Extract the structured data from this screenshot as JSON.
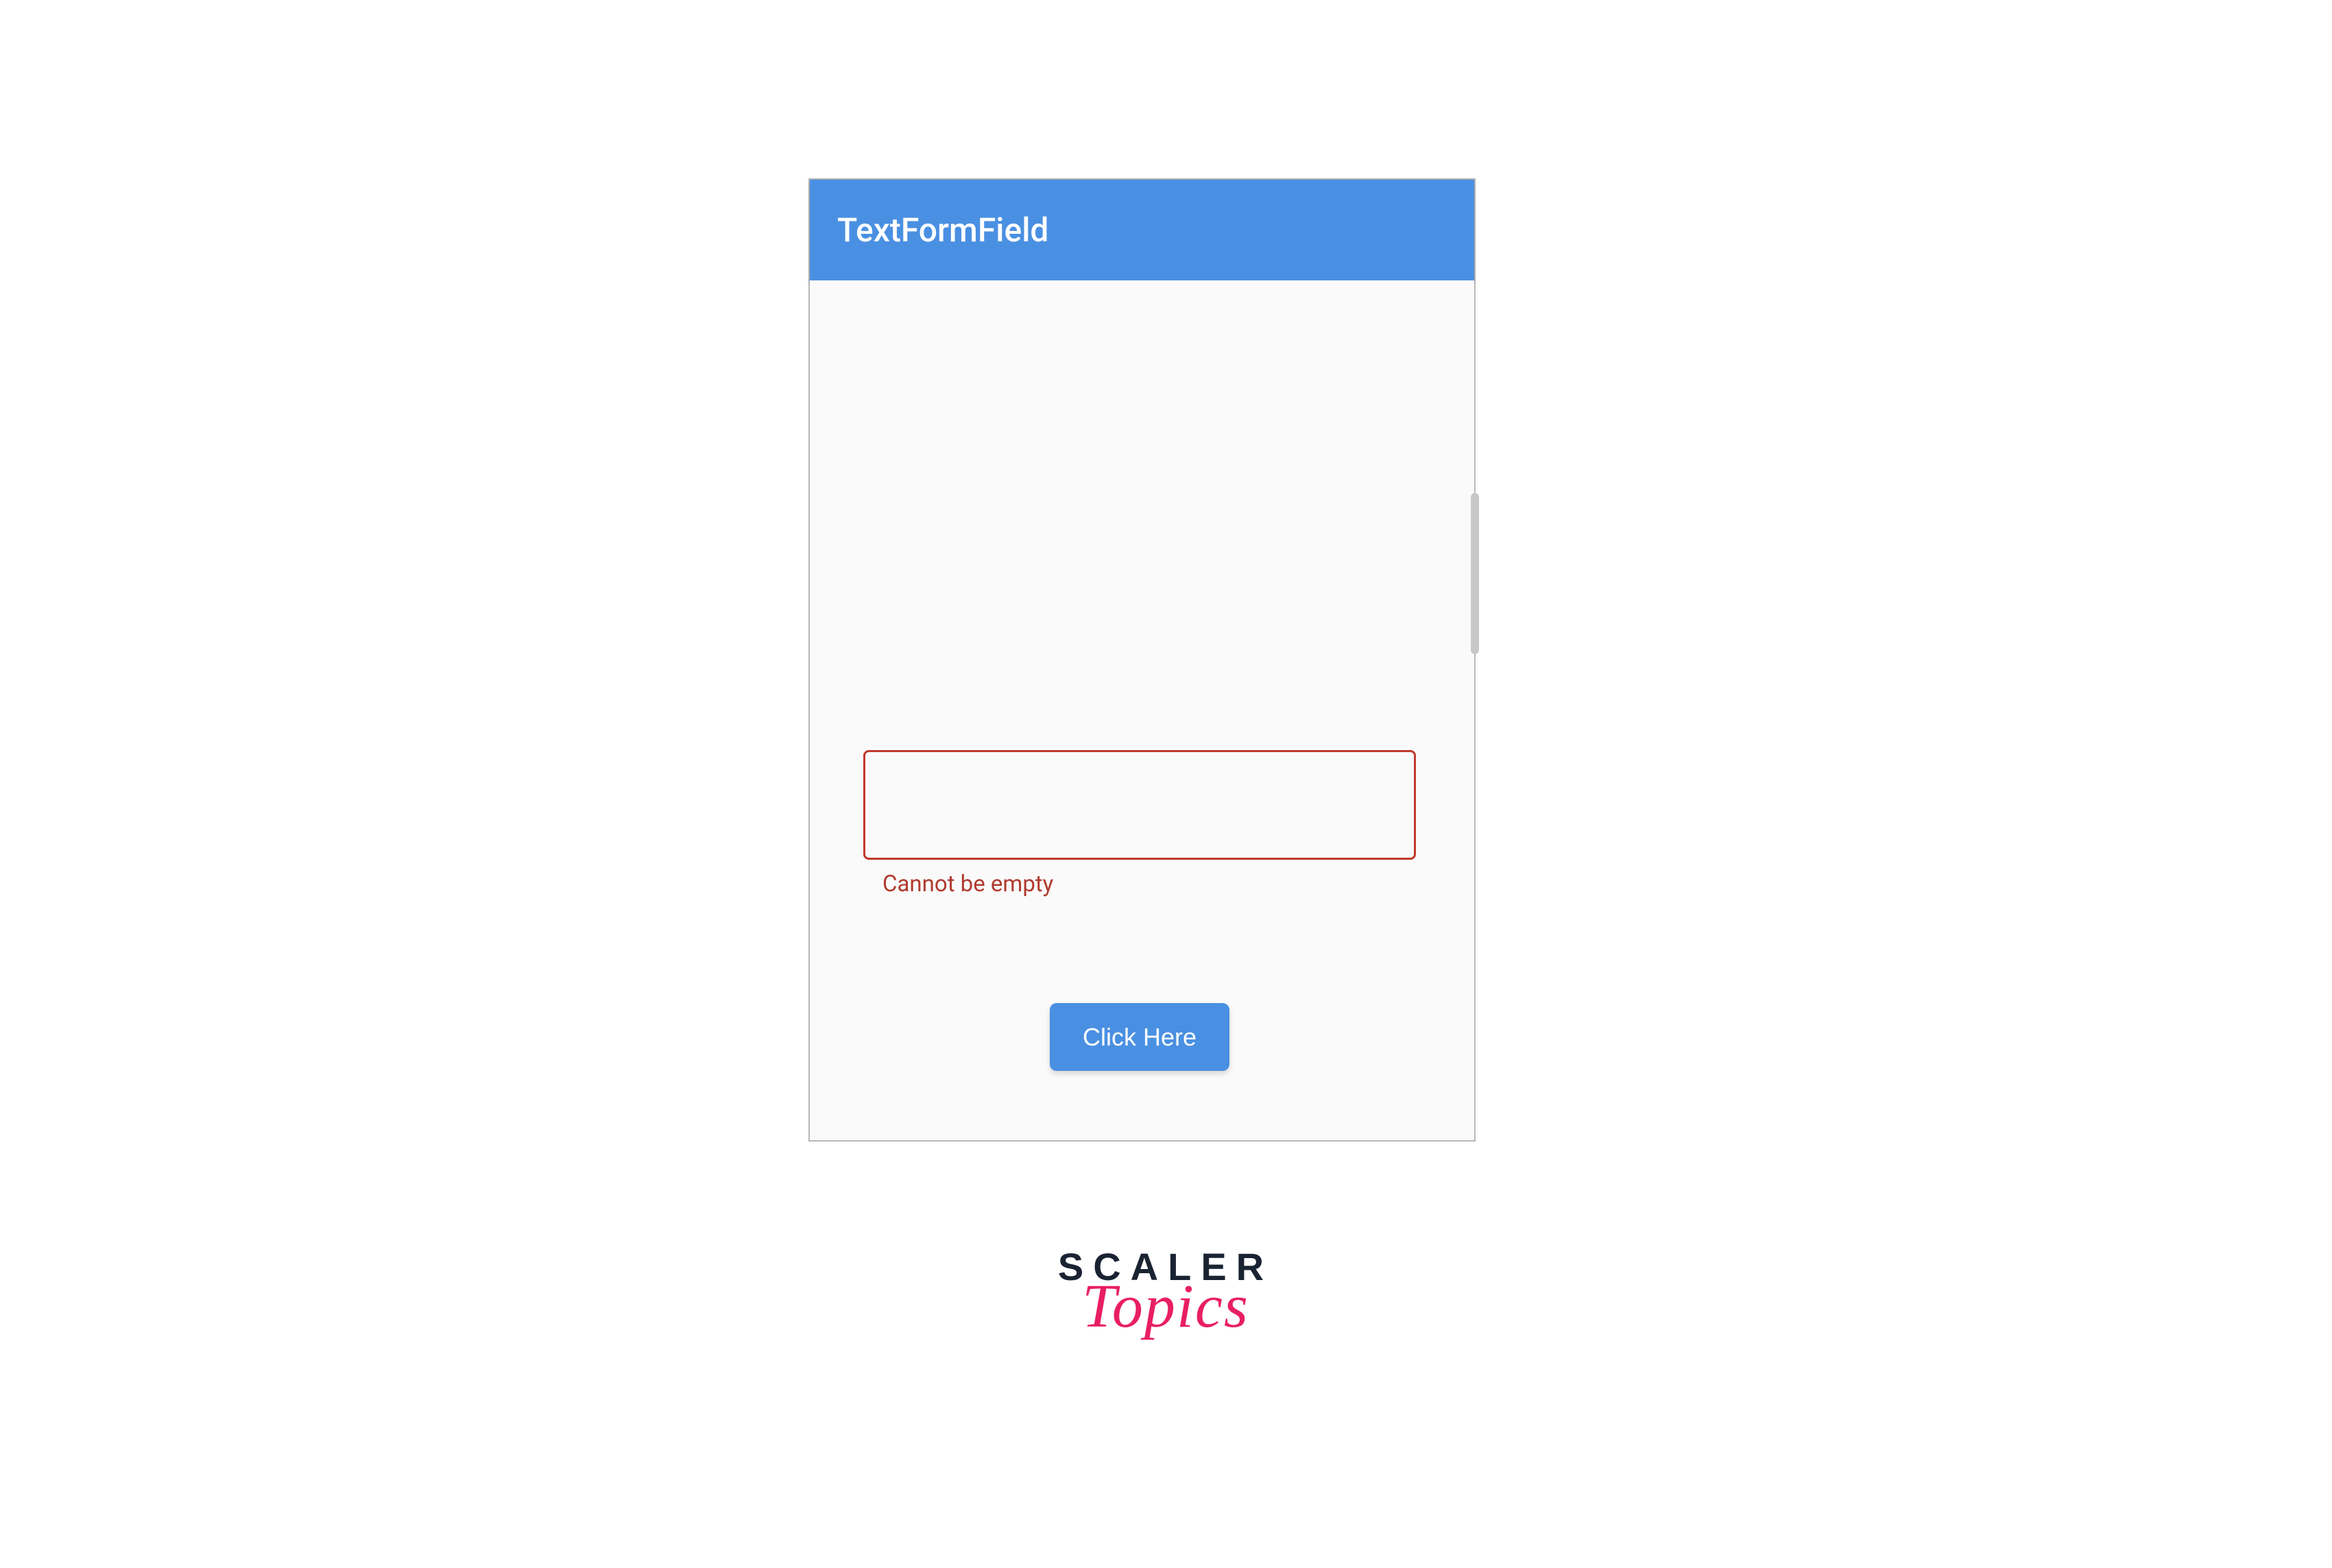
{
  "appBar": {
    "title": "TextFormField"
  },
  "form": {
    "input_value": "",
    "error_message": "Cannot be empty",
    "button_label": "Click Here"
  },
  "branding": {
    "line1": "SCALER",
    "line2": "Topics"
  },
  "colors": {
    "primary": "#4a90e2",
    "error": "#c0392b",
    "accent": "#e91e63",
    "dark": "#1a2332"
  }
}
